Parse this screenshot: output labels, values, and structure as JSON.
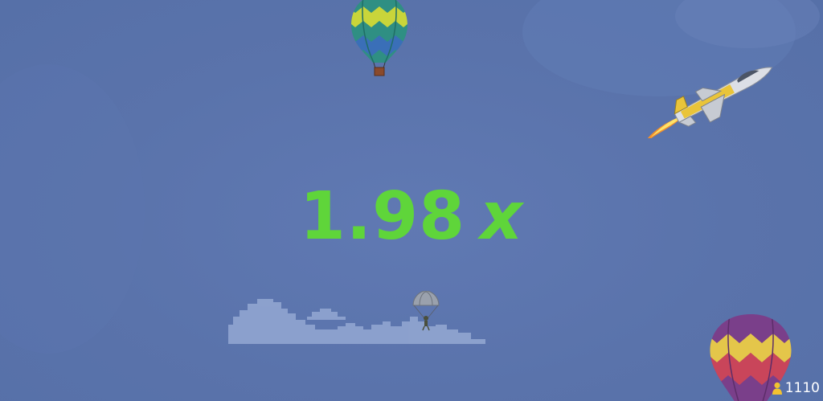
{
  "game": {
    "multiplier_value": "1.98",
    "multiplier_suffix": "x",
    "multiplier_color": "#5fd53a",
    "sky_color": "#5a74ac",
    "players_online": "1110",
    "players_icon": "person-icon"
  },
  "sprites": {
    "top_balloon_colors": [
      "#2f8f83",
      "#c9d53a",
      "#3a6fb8"
    ],
    "bottom_balloon_colors": [
      "#7a3f8a",
      "#e4c64a",
      "#c9455a"
    ],
    "jet": "jet-plane",
    "parachutist": "parachutist",
    "cloud": "pixel-cloud"
  }
}
